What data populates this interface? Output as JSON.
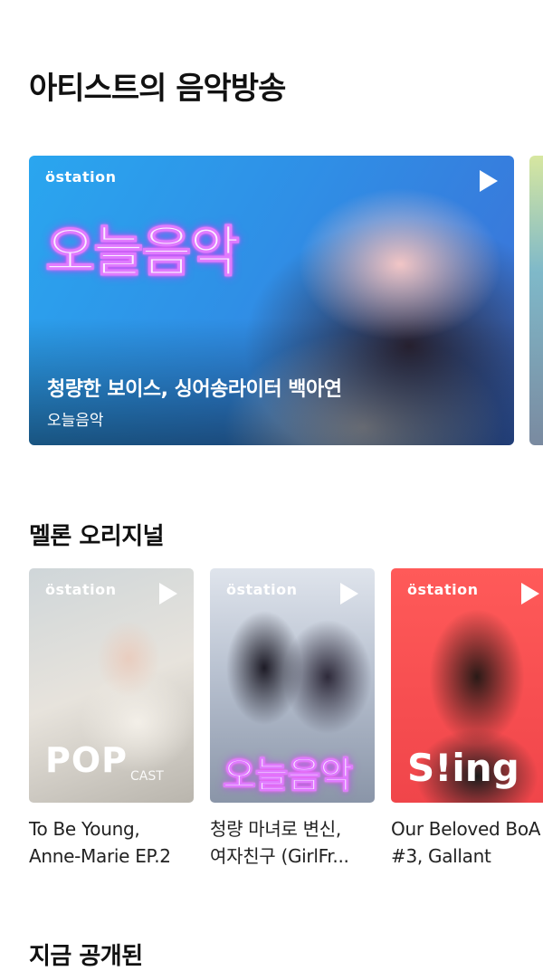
{
  "sections": {
    "artist_broadcast_title": "아티스트의 음악방송",
    "melon_original_title": "멜론 오리지널",
    "now_released_title": "지금 공개된"
  },
  "feature": {
    "brand": "station",
    "neon_title": "오늘음악",
    "headline": "청량한 보이스, 싱어송라이터 백아연",
    "subtitle": "오늘음악"
  },
  "originals": [
    {
      "brand": "station",
      "logo_main": "POP",
      "logo_sub": "CAST",
      "caption_line1": "To Be Young,",
      "caption_line2": "Anne-Marie EP.2"
    },
    {
      "brand": "station",
      "neon_title": "오늘음악",
      "caption_line1": "청량 마녀로 변신,",
      "caption_line2": "여자친구 (GirlFr..."
    },
    {
      "brand": "station",
      "logo_main": "S!ing",
      "caption_line1": "Our Beloved BoA",
      "caption_line2": "#3, Gallant"
    }
  ],
  "icons": {
    "play": "play-icon"
  }
}
